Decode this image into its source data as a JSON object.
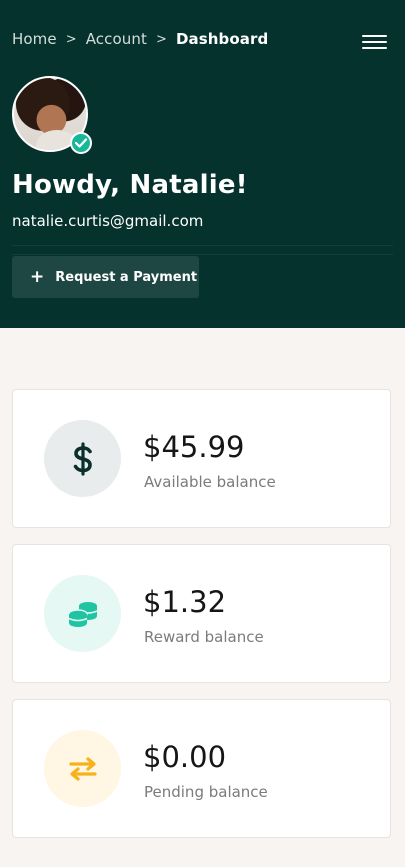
{
  "breadcrumb": {
    "items": [
      "Home",
      "Account",
      "Dashboard"
    ],
    "separator": ">"
  },
  "header": {
    "menu_icon": "hamburger-menu-icon",
    "greeting": "Howdy, Natalie!",
    "email": "natalie.curtis@gmail.com",
    "verified_icon": "check-badge-icon",
    "request_button": {
      "icon": "plus-icon",
      "label": "Request a Payment"
    }
  },
  "balances": [
    {
      "icon": "dollar-icon",
      "amount": "$45.99",
      "label": "Available balance",
      "accent": "#0b2f2c",
      "circle_bg": "#e9ecec"
    },
    {
      "icon": "coins-icon",
      "amount": "$1.32",
      "label": "Reward balance",
      "accent": "#1fc4a2",
      "circle_bg": "#e6f8f4"
    },
    {
      "icon": "transfer-arrows-icon",
      "amount": "$0.00",
      "label": "Pending balance",
      "accent": "#f6b21b",
      "circle_bg": "#fff6e3"
    }
  ],
  "colors": {
    "header_bg": "#06322e",
    "page_bg": "#f7f4f1",
    "verified": "#18b79a"
  }
}
